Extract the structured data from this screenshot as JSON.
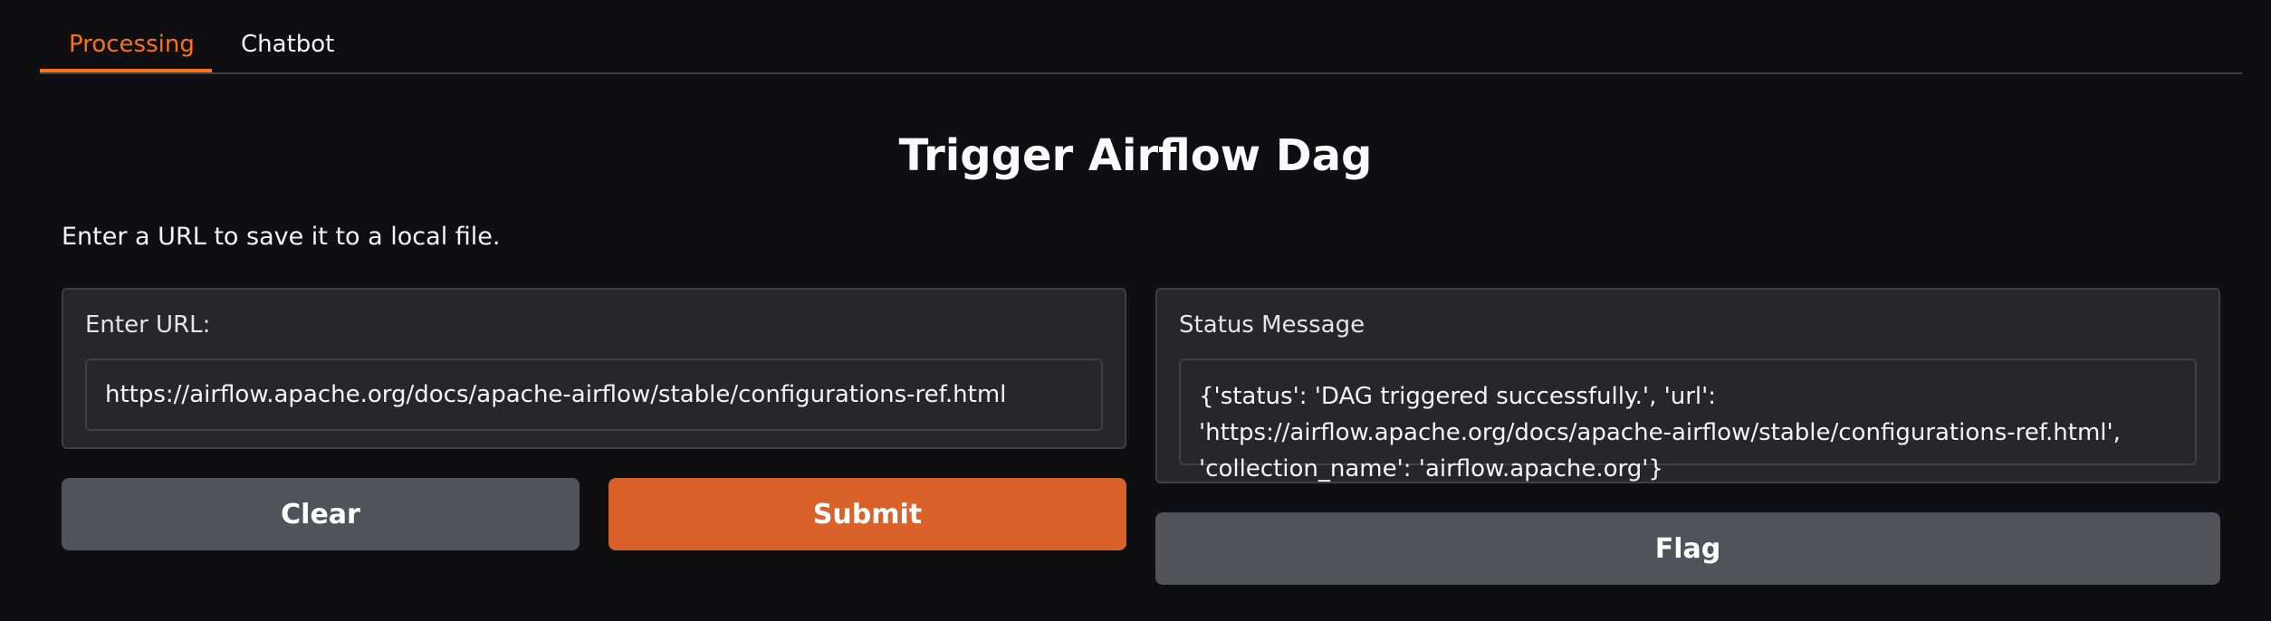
{
  "tabs": [
    {
      "label": "Processing",
      "active": true
    },
    {
      "label": "Chatbot",
      "active": false
    }
  ],
  "header": {
    "title": "Trigger Airflow Dag",
    "description": "Enter a URL to save it to a local file."
  },
  "input_panel": {
    "label": "Enter URL:",
    "value": "https://airflow.apache.org/docs/apache-airflow/stable/configurations-ref.html"
  },
  "output_panel": {
    "label": "Status Message",
    "value": "{'status': 'DAG triggered successfully.', 'url': 'https://airflow.apache.org/docs/apache-airflow/stable/configurations-ref.html', 'collection_name': 'airflow.apache.org'}"
  },
  "buttons": {
    "clear": "Clear",
    "submit": "Submit",
    "flag": "Flag"
  },
  "colors": {
    "background": "#0f0f11",
    "panel": "#27272a",
    "accent": "#f97316",
    "primary_button": "#d9622b",
    "secondary_button": "#52525b"
  }
}
